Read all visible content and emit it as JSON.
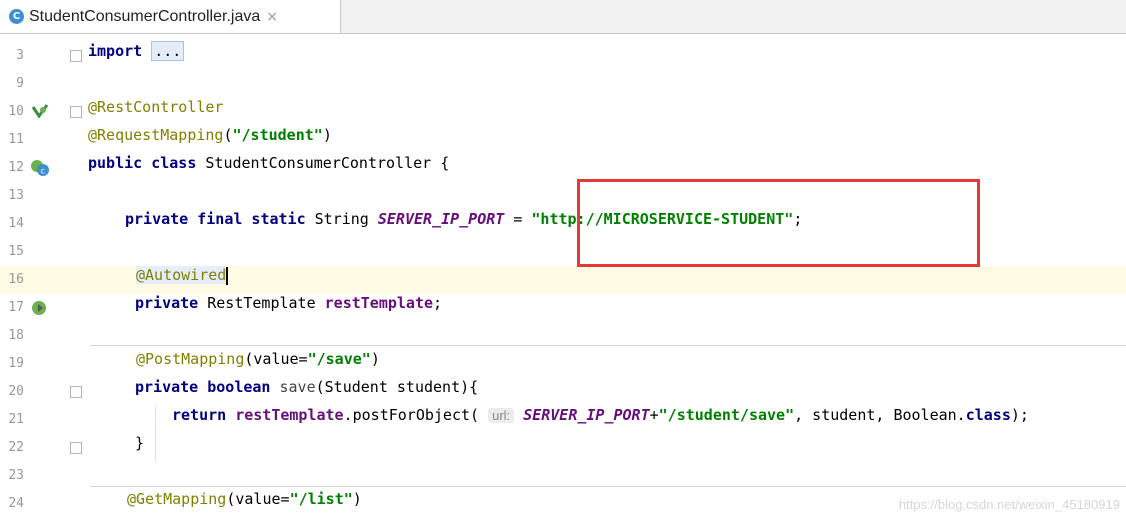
{
  "tab": {
    "icon": "class-c-icon",
    "icon_letter": "C",
    "title": "StudentConsumerController.java",
    "close": "×"
  },
  "lines": {
    "l3": {
      "num": "3",
      "kw": "import",
      "folded": "..."
    },
    "l9": {
      "num": "9"
    },
    "l10": {
      "num": "10",
      "ann": "@RestController"
    },
    "l11": {
      "num": "11",
      "ann": "@RequestMapping",
      "p1": "(",
      "str": "\"/student\"",
      "p2": ")"
    },
    "l12": {
      "num": "12",
      "kw": "public class",
      "rest": " StudentConsumerController {"
    },
    "l13": {
      "num": "13"
    },
    "l14": {
      "num": "14",
      "kw": "private final static",
      "type": " String ",
      "const": "SERVER_IP_PORT",
      "eq": " = ",
      "str": "\"http://MICROSERVICE-STUDENT\"",
      "semi": ";"
    },
    "l15": {
      "num": "15"
    },
    "l16": {
      "num": "16",
      "ann": "@Autowired"
    },
    "l17": {
      "num": "17",
      "kw": "private",
      "type": " RestTemplate ",
      "field": "restTemplate",
      "semi": ";"
    },
    "l18": {
      "num": "18"
    },
    "l19": {
      "num": "19",
      "ann": "@PostMapping",
      "p1": "(value=",
      "str": "\"/save\"",
      "p2": ")"
    },
    "l20": {
      "num": "20",
      "kw": "private boolean",
      "method": " save",
      "rest": "(Student student){"
    },
    "l21": {
      "num": "21",
      "kw": "return",
      "field": " restTemplate",
      "call": ".postForObject(",
      "hint": "url:",
      "const": "SERVER_IP_PORT",
      "plus": "+",
      "str": "\"/student/save\"",
      "rest": ", student, Boolean.",
      "kw2": "class",
      "end": ");"
    },
    "l22": {
      "num": "22",
      "rest": "}"
    },
    "l23": {
      "num": "23"
    },
    "l24": {
      "num": "24",
      "ann": "@GetMapping",
      "p1": "(value=",
      "str": "\"/list\"",
      "p2": ")"
    }
  },
  "watermark": "https://blog.csdn.net/weixin_45180919",
  "colors": {
    "keyword": "#000080",
    "annotation": "#808000",
    "string": "#008000",
    "constant": "#660e7a",
    "highlight_box": "#e53935",
    "current_line": "#fffae3"
  }
}
